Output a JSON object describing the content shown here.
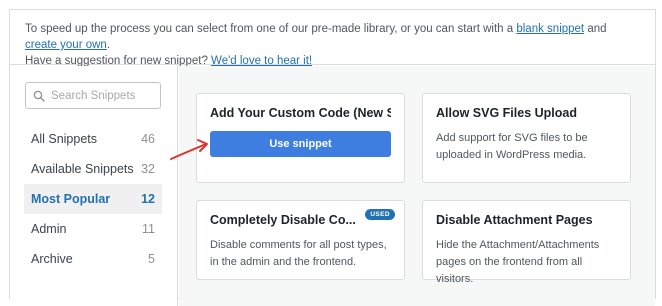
{
  "intro": {
    "line1_prefix": "To speed up the process you can select from one of our pre-made library, or you can start with a",
    "blank_snippet_link": "blank snippet",
    "and": "and",
    "create_own_link": "create your own",
    "line1_suffix": ".",
    "line2_prefix": "Have a suggestion for new snippet?",
    "love_link": "We'd love to hear it!"
  },
  "search": {
    "placeholder": "Search Snippets"
  },
  "categories": [
    {
      "label": "All Snippets",
      "count": "46"
    },
    {
      "label": "Available Snippets",
      "count": "32"
    },
    {
      "label": "Most Popular",
      "count": "12"
    },
    {
      "label": "Admin",
      "count": "11"
    },
    {
      "label": "Archive",
      "count": "5"
    }
  ],
  "cards": [
    {
      "title": "Add Your Custom Code (New Sn...",
      "button": "Use snippet"
    },
    {
      "title": "Allow SVG Files Upload",
      "desc": "Add support for SVG files to be uploaded in WordPress media."
    },
    {
      "title": "Completely Disable Co...",
      "badge": "USED",
      "desc": "Disable comments for all post types, in the admin and the frontend."
    },
    {
      "title": "Disable Attachment Pages",
      "desc": "Hide the Attachment/Attachments pages on the frontend from all visitors."
    }
  ],
  "colors": {
    "accent": "#2271b1",
    "button": "#3e7ee0",
    "arrow": "#e0322d"
  }
}
